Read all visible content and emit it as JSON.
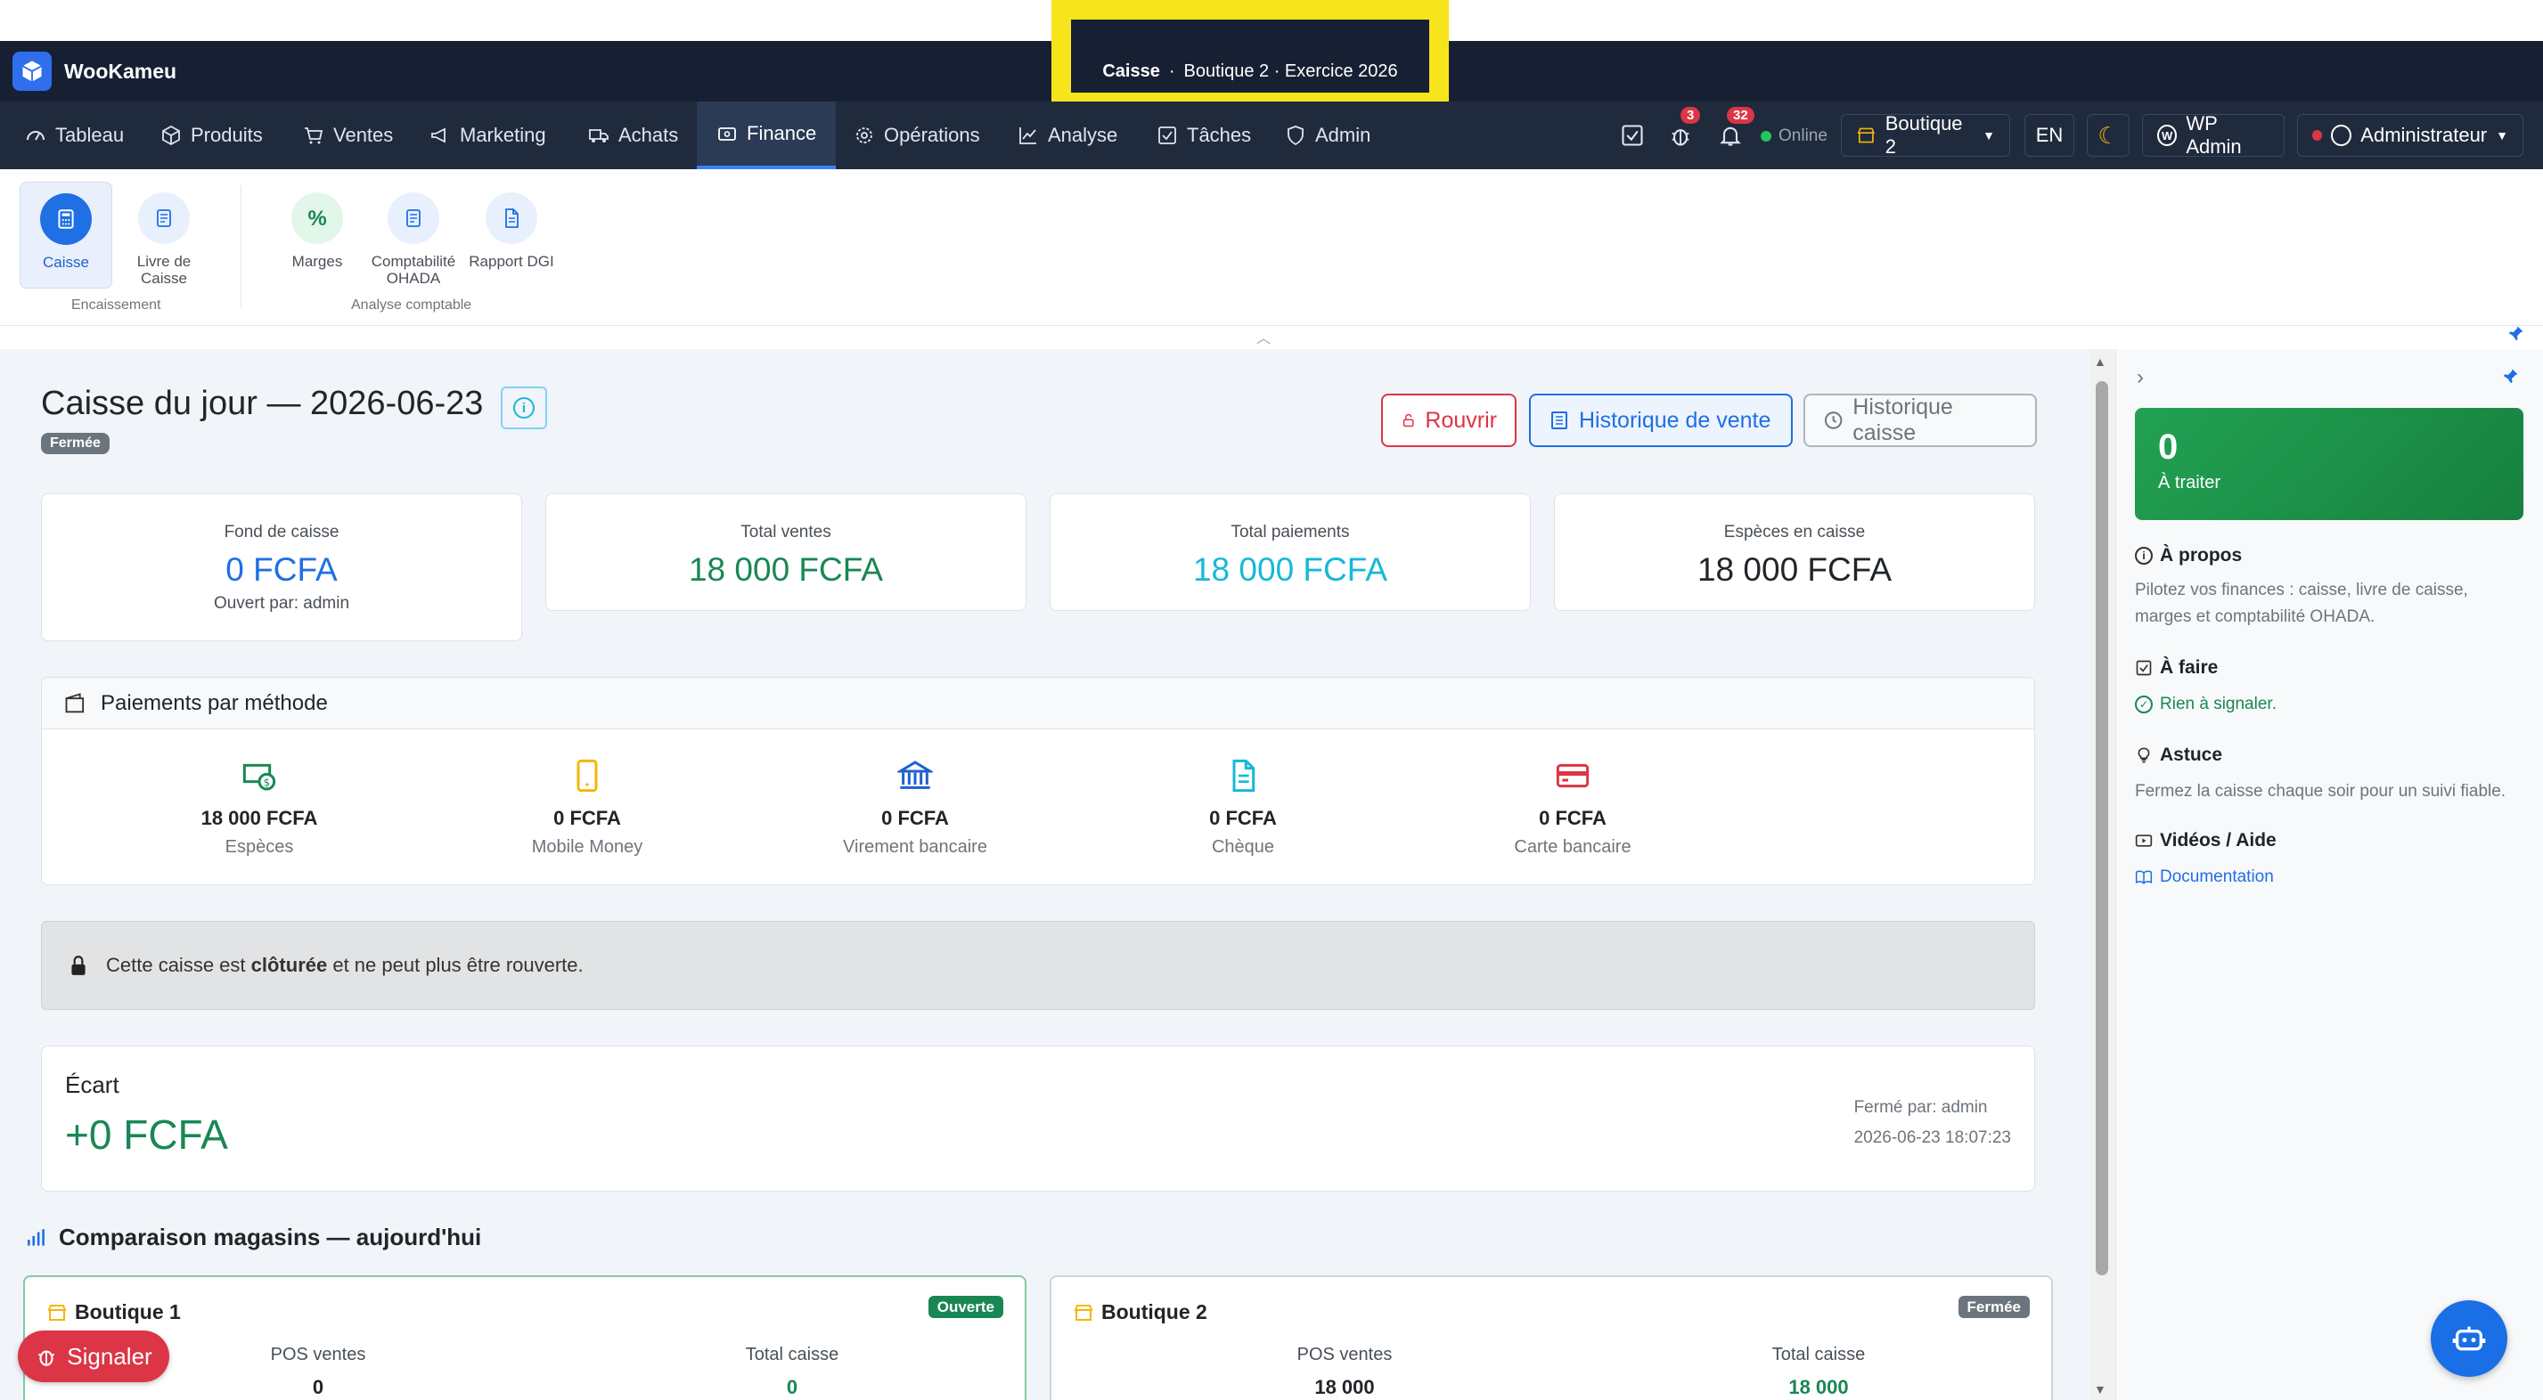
{
  "app": {
    "brand": "WooKameu"
  },
  "context": {
    "page": "Caisse",
    "sep": "·",
    "store_year": "Boutique 2 · Exercice 2026"
  },
  "nav": {
    "items": [
      "Tableau",
      "Produits",
      "Ventes",
      "Marketing",
      "Achats",
      "Finance",
      "Opérations",
      "Analyse",
      "Tâches",
      "Admin"
    ],
    "bug_count": "3",
    "notif_count": "32",
    "online": "Online",
    "store": "Boutique 2",
    "lang": "EN",
    "wp_admin": "WP Admin",
    "user": "Administrateur"
  },
  "subnav": {
    "caisse": "Caisse",
    "livre_l1": "Livre de",
    "livre_l2": "Caisse",
    "group1": "Encaissement",
    "marges": "Marges",
    "compta_l1": "Comptabilité",
    "compta_l2": "OHADA",
    "rapport": "Rapport DGI",
    "group2": "Analyse comptable"
  },
  "page": {
    "title": "Caisse du jour — 2026-06-23",
    "status": "Fermée",
    "btn_reopen": "Rouvrir",
    "btn_sales_history": "Historique de vente",
    "btn_cash_history": "Historique caisse"
  },
  "stats": {
    "fond_label": "Fond de caisse",
    "fond_value": "0 FCFA",
    "fond_sub": "Ouvert par: admin",
    "ventes_label": "Total ventes",
    "ventes_value": "18 000 FCFA",
    "paiements_label": "Total paiements",
    "paiements_value": "18 000 FCFA",
    "especes_label": "Espèces en caisse",
    "especes_value": "18 000 FCFA"
  },
  "payments": {
    "title": "Paiements par méthode",
    "items": [
      {
        "amount": "18 000 FCFA",
        "name": "Espèces"
      },
      {
        "amount": "0 FCFA",
        "name": "Mobile Money"
      },
      {
        "amount": "0 FCFA",
        "name": "Virement bancaire"
      },
      {
        "amount": "0 FCFA",
        "name": "Chèque"
      },
      {
        "amount": "0 FCFA",
        "name": "Carte bancaire"
      }
    ]
  },
  "alert": {
    "pre": "Cette caisse est ",
    "bold": "clôturée",
    "post": " et ne peut plus être rouverte."
  },
  "ecart": {
    "label": "Écart",
    "value": "+0 FCFA",
    "closed_by": "Fermé par: admin",
    "closed_at": "2026-06-23 18:07:23"
  },
  "compare": {
    "title": "Comparaison magasins — aujourd'hui",
    "stores": [
      {
        "name": "Boutique 1",
        "status": "Ouverte",
        "pos_label": "POS ventes",
        "pos_value": "0",
        "total_label": "Total caisse",
        "total_value": "0"
      },
      {
        "name": "Boutique 2",
        "status": "Fermée",
        "pos_label": "POS ventes",
        "pos_value": "18 000",
        "total_label": "Total caisse",
        "total_value": "18 000"
      }
    ]
  },
  "sidebar": {
    "todo_count": "0",
    "todo_label": "À traiter",
    "about_title": "À propos",
    "about_text": "Pilotez vos finances : caisse, livre de caisse, marges et comptabilité OHADA.",
    "todo_title": "À faire",
    "todo_text": "Rien à signaler.",
    "tip_title": "Astuce",
    "tip_text": "Fermez la caisse chaque soir pour un suivi fiable.",
    "videos_title": "Vidéos / Aide",
    "doc_link": "Documentation"
  },
  "floating": {
    "signaler": "Signaler"
  },
  "colors": {
    "navy": "#172033",
    "blue": "#1f6fe5",
    "green": "#198754",
    "cyan": "#17b8d8",
    "red": "#dc3545"
  }
}
